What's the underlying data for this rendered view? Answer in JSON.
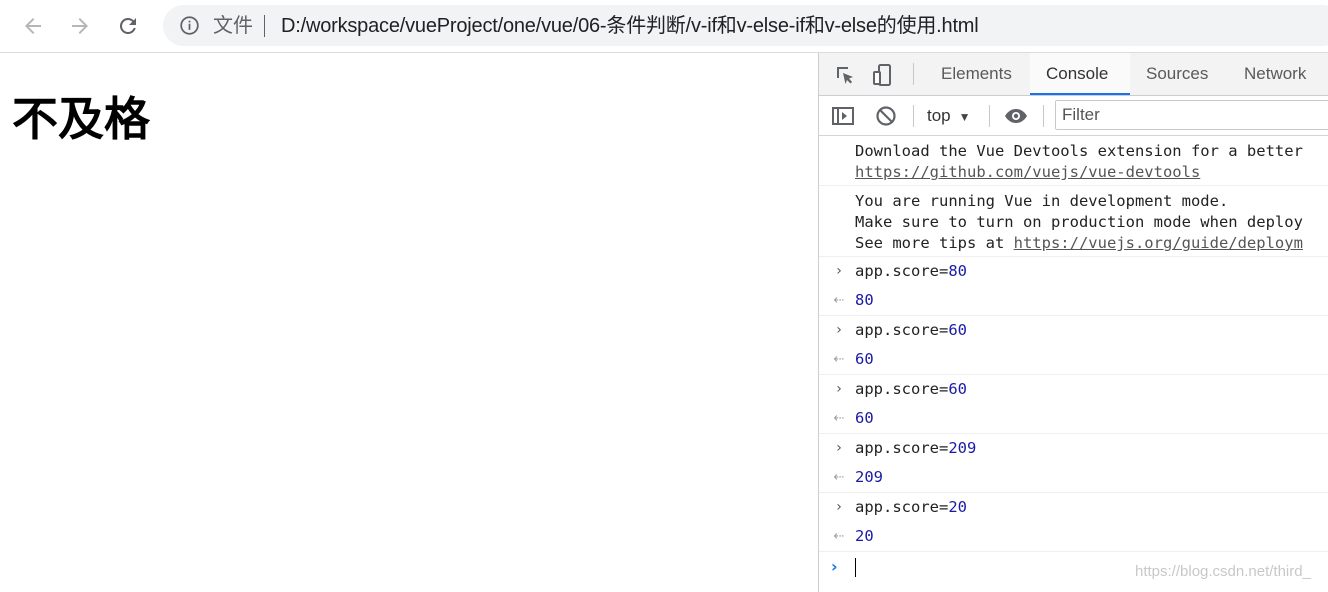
{
  "browser": {
    "scheme_label": "文件",
    "url": "D:/workspace/vueProject/one/vue/06-条件判断/v-if和v-else-if和v-else的使用.html"
  },
  "page": {
    "heading": "不及格"
  },
  "devtools": {
    "tabs": [
      {
        "label": "Elements"
      },
      {
        "label": "Console"
      },
      {
        "label": "Sources"
      },
      {
        "label": "Network"
      }
    ],
    "active_tab": "Console",
    "context": "top",
    "filter_placeholder": "Filter"
  },
  "console": {
    "info_messages": [
      {
        "line1": "Download the Vue Devtools extension for a better",
        "link": "https://github.com/vuejs/vue-devtools"
      },
      {
        "line1": "You are running Vue in development mode.",
        "line2": "Make sure to turn on production mode when deploy",
        "line3_prefix": "See more tips at ",
        "line3_link": "https://vuejs.org/guide/deploym"
      }
    ],
    "entries": [
      {
        "expr": "app.score",
        "op": "=",
        "value": "80",
        "result": "80"
      },
      {
        "expr": "app.score",
        "op": "=",
        "value": "60",
        "result": "60"
      },
      {
        "expr": "app.score",
        "op": "=",
        "value": "60",
        "result": "60"
      },
      {
        "expr": "app.score",
        "op": "=",
        "value": "209",
        "result": "209"
      },
      {
        "expr": "app.score",
        "op": "=",
        "value": "20",
        "result": "20"
      }
    ]
  },
  "watermark": "https://blog.csdn.net/third_",
  "icons": {
    "back": "arrow-left-icon",
    "forward": "arrow-right-icon",
    "reload": "reload-icon",
    "info": "info-icon",
    "inspect": "inspect-element-icon",
    "device": "device-toolbar-icon",
    "sidebar": "sidebar-toggle-icon",
    "clear": "clear-console-icon",
    "live": "eye-icon"
  },
  "colors": {
    "accent": "#1a73e8",
    "number": "#1a1aa6"
  }
}
